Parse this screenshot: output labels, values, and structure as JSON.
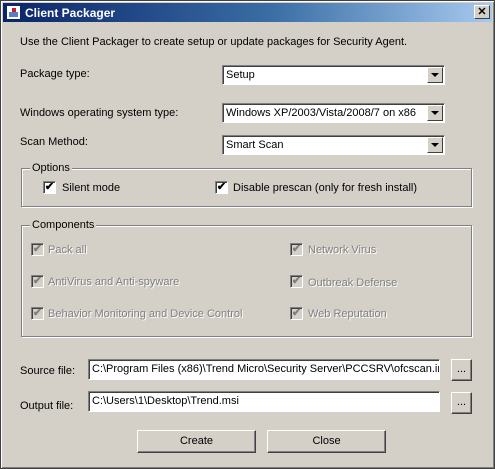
{
  "window": {
    "title": "Client Packager",
    "close_glyph": "✕"
  },
  "intro_text": "Use the Client Packager to create setup or update packages for Security Agent.",
  "fields": {
    "package_type": {
      "label": "Package type:",
      "value": "Setup"
    },
    "os_type": {
      "label": "Windows operating system type:",
      "value": "Windows XP/2003/Vista/2008/7 on x86"
    },
    "scan_method": {
      "label": "Scan Method:",
      "value": "Smart Scan"
    }
  },
  "options": {
    "legend": "Options",
    "silent_mode": {
      "label": "Silent mode",
      "checked": true
    },
    "disable_prescan": {
      "label": "Disable prescan (only for fresh install)",
      "checked": true
    }
  },
  "components": {
    "legend": "Components",
    "items": [
      {
        "label": "Pack all",
        "checked": true,
        "enabled": false
      },
      {
        "label": "AntiVirus and Anti-spyware",
        "checked": true,
        "enabled": false
      },
      {
        "label": "Behavior Monitoring and Device Control",
        "checked": true,
        "enabled": false
      },
      {
        "label": "Network Virus",
        "checked": true,
        "enabled": false
      },
      {
        "label": "Outbreak Defense",
        "checked": true,
        "enabled": false
      },
      {
        "label": "Web Reputation",
        "checked": true,
        "enabled": false
      }
    ]
  },
  "source_file": {
    "label": "Source file:",
    "value": "C:\\Program Files (x86)\\Trend Micro\\Security Server\\PCCSRV\\ofcscan.ini",
    "browse_label": "..."
  },
  "output_file": {
    "label": "Output file:",
    "value": "C:\\Users\\1\\Desktop\\Trend.msi",
    "browse_label": "..."
  },
  "buttons": {
    "create": "Create",
    "close": "Close"
  },
  "check_glyph": "✔"
}
